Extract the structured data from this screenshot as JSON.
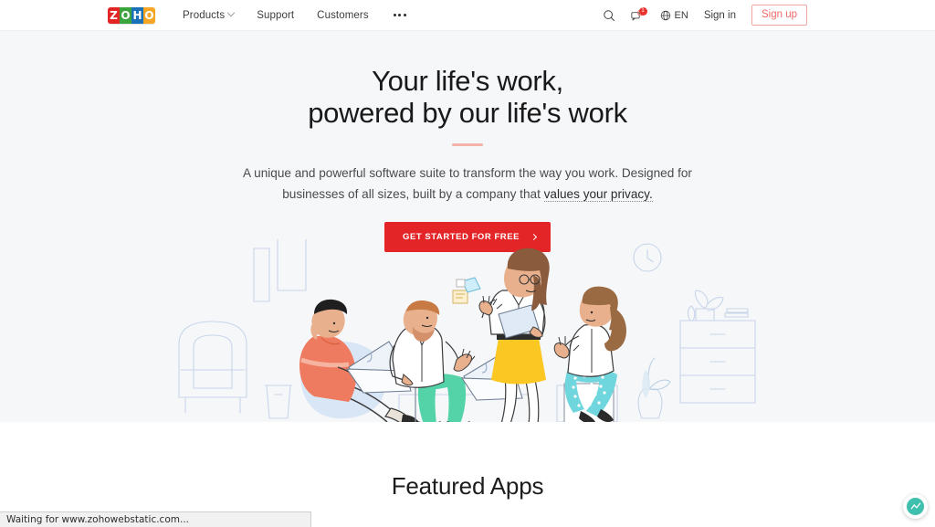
{
  "header": {
    "logo": {
      "alt": "Zoho",
      "tiles": [
        {
          "letter": "Z",
          "color": "#e42527"
        },
        {
          "letter": "O",
          "color": "#3ca43c"
        },
        {
          "letter": "H",
          "color": "#1b71b8"
        },
        {
          "letter": "O",
          "color": "#f5a623"
        }
      ]
    },
    "nav": [
      {
        "label": "Products",
        "has_dropdown": true
      },
      {
        "label": "Support",
        "has_dropdown": false
      },
      {
        "label": "Customers",
        "has_dropdown": false
      }
    ],
    "more_label": "•••",
    "search_icon": "search-icon",
    "notifications": {
      "icon": "chat-bubble-icon",
      "badge": "1"
    },
    "language": {
      "icon": "globe-icon",
      "label": "EN"
    },
    "sign_in_label": "Sign in",
    "sign_up_label": "Sign up",
    "sign_up_color": "#ef6b67"
  },
  "hero": {
    "background": "#f6f7f9",
    "headline_line1": "Your life's work,",
    "headline_line2": "powered by our life's work",
    "rule_color": "#f4b2ad",
    "subtitle_part1": "A unique and powerful software suite to transform the way you work. Designed for businesses of all sizes, built by a company that ",
    "subtitle_link": "values your privacy.",
    "cta_label": "GET STARTED FOR FREE",
    "cta_color": "#e42527",
    "cta_arrow": "chevron-right-icon",
    "illustration_alt": "People working together with laptops in an office lounge"
  },
  "featured": {
    "title": "Featured Apps"
  },
  "statusbar": {
    "text": "Waiting for www.zohowebstatic.com..."
  },
  "widget": {
    "name": "chat-widget",
    "color": "#3fbfad"
  }
}
